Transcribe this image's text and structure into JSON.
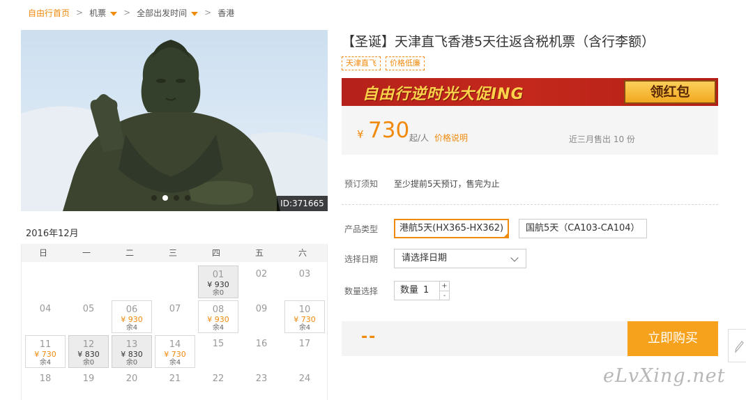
{
  "breadcrumb": {
    "home": "自由行首页",
    "sep": ">",
    "category": "机票",
    "time": "全部出发时间",
    "destination": "香港"
  },
  "gallery": {
    "photo_id": "ID:371665",
    "dots_total": 4,
    "dots_active": 2
  },
  "calendar": {
    "month": "2016年12月",
    "weekdays": [
      "日",
      "一",
      "二",
      "三",
      "四",
      "五",
      "六"
    ],
    "days": {
      "d01": {
        "date": "01",
        "price": "¥ 930",
        "stock": "余0"
      },
      "d02": {
        "date": "02"
      },
      "d03": {
        "date": "03"
      },
      "d04": {
        "date": "04"
      },
      "d05": {
        "date": "05"
      },
      "d06": {
        "date": "06",
        "price": "¥ 930",
        "stock": "余4"
      },
      "d07": {
        "date": "07"
      },
      "d08": {
        "date": "08",
        "price": "¥ 930",
        "stock": "余4"
      },
      "d09": {
        "date": "09"
      },
      "d10": {
        "date": "10",
        "price": "¥ 730",
        "stock": "余4"
      },
      "d11": {
        "date": "11",
        "price": "¥ 730",
        "stock": "余4"
      },
      "d12": {
        "date": "12",
        "price": "¥ 830",
        "stock": "余0"
      },
      "d13": {
        "date": "13",
        "price": "¥ 830",
        "stock": "余0"
      },
      "d14": {
        "date": "14",
        "price": "¥ 730",
        "stock": "余4"
      },
      "d15": {
        "date": "15"
      },
      "d16": {
        "date": "16"
      },
      "d17": {
        "date": "17"
      },
      "d18": {
        "date": "18"
      },
      "d19": {
        "date": "19"
      },
      "d20": {
        "date": "20"
      },
      "d21": {
        "date": "21"
      },
      "d22": {
        "date": "22"
      },
      "d23": {
        "date": "23"
      },
      "d24": {
        "date": "24"
      }
    }
  },
  "product": {
    "title": "【圣诞】天津直飞香港5天往返含税机票（含行李额）",
    "tags": [
      "天津直飞",
      "价格低廉"
    ]
  },
  "banner": {
    "text": "自由行逆时光大促ING",
    "button": "领红包"
  },
  "price": {
    "currency": "¥",
    "amount": "730",
    "unit": "起/人",
    "explain_link": "价格说明",
    "sold": "近三月售出 10 份"
  },
  "booking": {
    "notice_label": "预订须知",
    "notice_text": "至少提前5天预订，售完为止",
    "type_label": "产品类型",
    "options": [
      "港航5天(HX365-HX362)",
      "国航5天（CA103-CA104）"
    ],
    "selected_option": 0,
    "date_label": "选择日期",
    "date_placeholder": "请选择日期",
    "qty_label": "数量选择",
    "qty_prefix": "数量",
    "qty_value": "1",
    "qty_plus": "+",
    "qty_minus": "-"
  },
  "buybar": {
    "total": "--",
    "buy_button": "立即购买"
  },
  "watermark": "eLvXing.net",
  "colors": {
    "accent": "#f08a0c",
    "buy": "#f7a21c",
    "banner": "#c4281c"
  }
}
